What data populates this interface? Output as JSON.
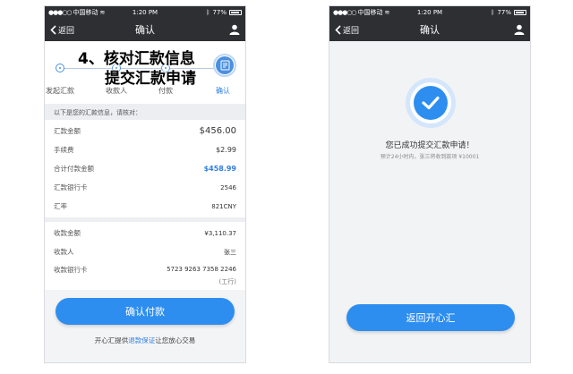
{
  "status_bar": {
    "carrier": "中国移动",
    "time": "1:20 PM",
    "battery": "77%"
  },
  "confirm_screen": {
    "nav": {
      "back_label": "返回",
      "title": "确认"
    },
    "steps": [
      {
        "label": "发起汇款"
      },
      {
        "label": "收款人"
      },
      {
        "label": "付款"
      },
      {
        "label": "确认",
        "active": true
      }
    ],
    "hint": "以下是您的汇款信息，请核对：",
    "send_rows": [
      {
        "label": "汇款金额",
        "value": "$456.00"
      },
      {
        "label": "手续费",
        "value": "$2.99"
      },
      {
        "label": "合计付款金额",
        "value": "$458.99"
      },
      {
        "label": "汇款银行卡",
        "value": "2546"
      },
      {
        "label": "汇率",
        "value": "821CNY"
      }
    ],
    "receive_rows": [
      {
        "label": "收款金额",
        "value": "¥3,110.37"
      },
      {
        "label": "收款人",
        "value": "张三"
      },
      {
        "label": "收款银行卡",
        "value": "5723 9263 7358 2246",
        "sub": "(工行)"
      }
    ],
    "confirm_button": "确认付款",
    "footer": {
      "prefix": "开心汇提供",
      "link": "退款保证",
      "suffix": "让您放心交易"
    }
  },
  "overlay_caption": {
    "line1": "4、核对汇款信息",
    "line2": "提交汇款申请"
  },
  "success_screen": {
    "nav": {
      "back_label": "返回",
      "title": "确认"
    },
    "title": "您已成功提交汇款申请！",
    "subtitle": "预计24小时内，张三将收到款项 ¥10001",
    "button": "返回开心汇"
  },
  "colors": {
    "accent": "#2d8ef0",
    "navbar": "#2d2f33",
    "highlight": "#2f7fe0"
  }
}
